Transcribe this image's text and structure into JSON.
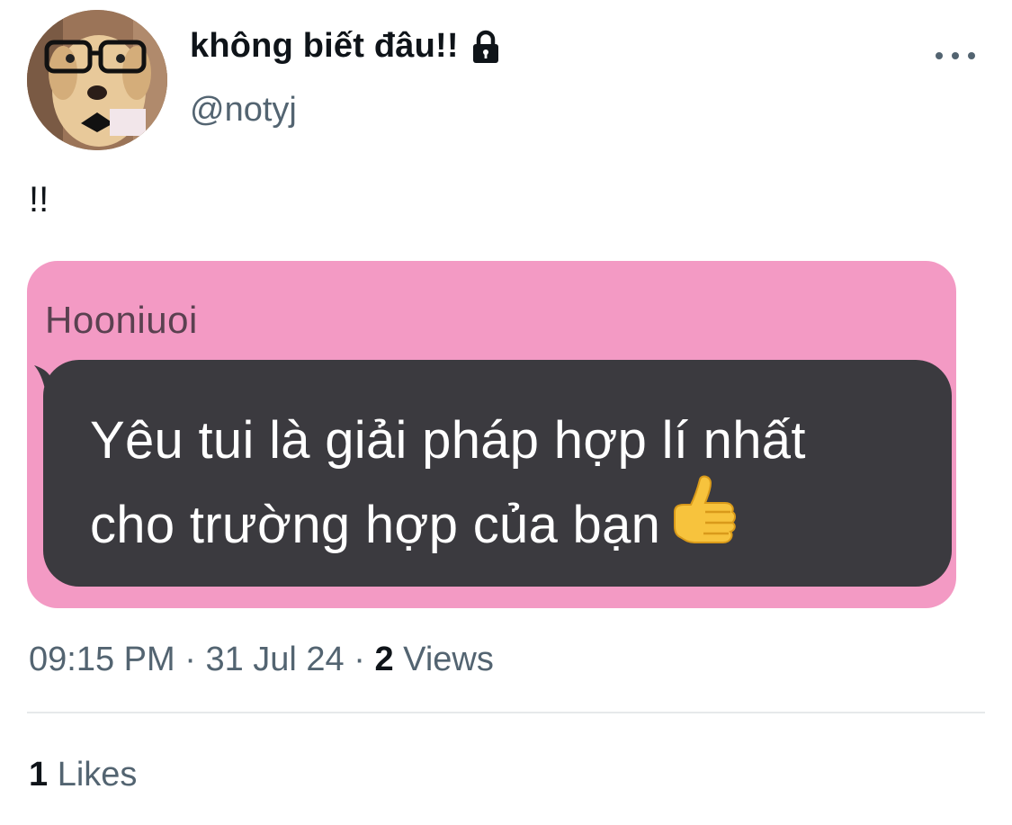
{
  "author": {
    "display_name": "không biết đâu!!",
    "handle": "@notyj",
    "avatar_icon": "dog-with-glasses-avatar",
    "lock_icon": "lock-icon"
  },
  "more_icon": "more-horizontal-icon",
  "tweet": {
    "text": "!!"
  },
  "media": {
    "sender": "Hooniuoi",
    "message_line1": "Yêu tui là giải pháp hợp lí nhất",
    "message_line2": "cho trường hợp của bạn",
    "emoji_icon": "thumbs-up-icon",
    "background_color": "#f39ac4",
    "bubble_color": "#3b3a3f"
  },
  "meta": {
    "time": "09:15 PM",
    "separator": "·",
    "date": "31 Jul 24",
    "views_count": "2",
    "views_label": "Views"
  },
  "engagement": {
    "likes_count": "1",
    "likes_label": "Likes"
  }
}
